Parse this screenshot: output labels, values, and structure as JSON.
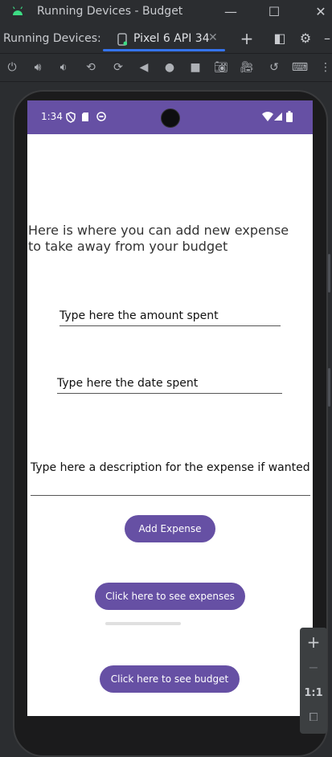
{
  "window": {
    "title": "Running Devices - Budget"
  },
  "tabbar": {
    "section_label": "Running Devices:",
    "device_tab": "Pixel 6 API 34"
  },
  "phone": {
    "status_time": "1:34",
    "intro_text": "Here is where you can add new expense to take away from your budget",
    "amount_field": "Type here the amount spent",
    "date_field": "Type here the date spent",
    "description_field": "Type here a description for the expense if wanted",
    "add_button": "Add Expense",
    "see_expenses_button": "Click here to see expenses",
    "see_budget_button": "Click here to see budget"
  },
  "zoom_controls": {
    "zoom_in": "+",
    "zoom_out": "−",
    "actual_size": "1:1"
  },
  "colors": {
    "accent": "#6650a4",
    "ide_bg": "#2b2d30",
    "tab_underline": "#3574f0"
  }
}
